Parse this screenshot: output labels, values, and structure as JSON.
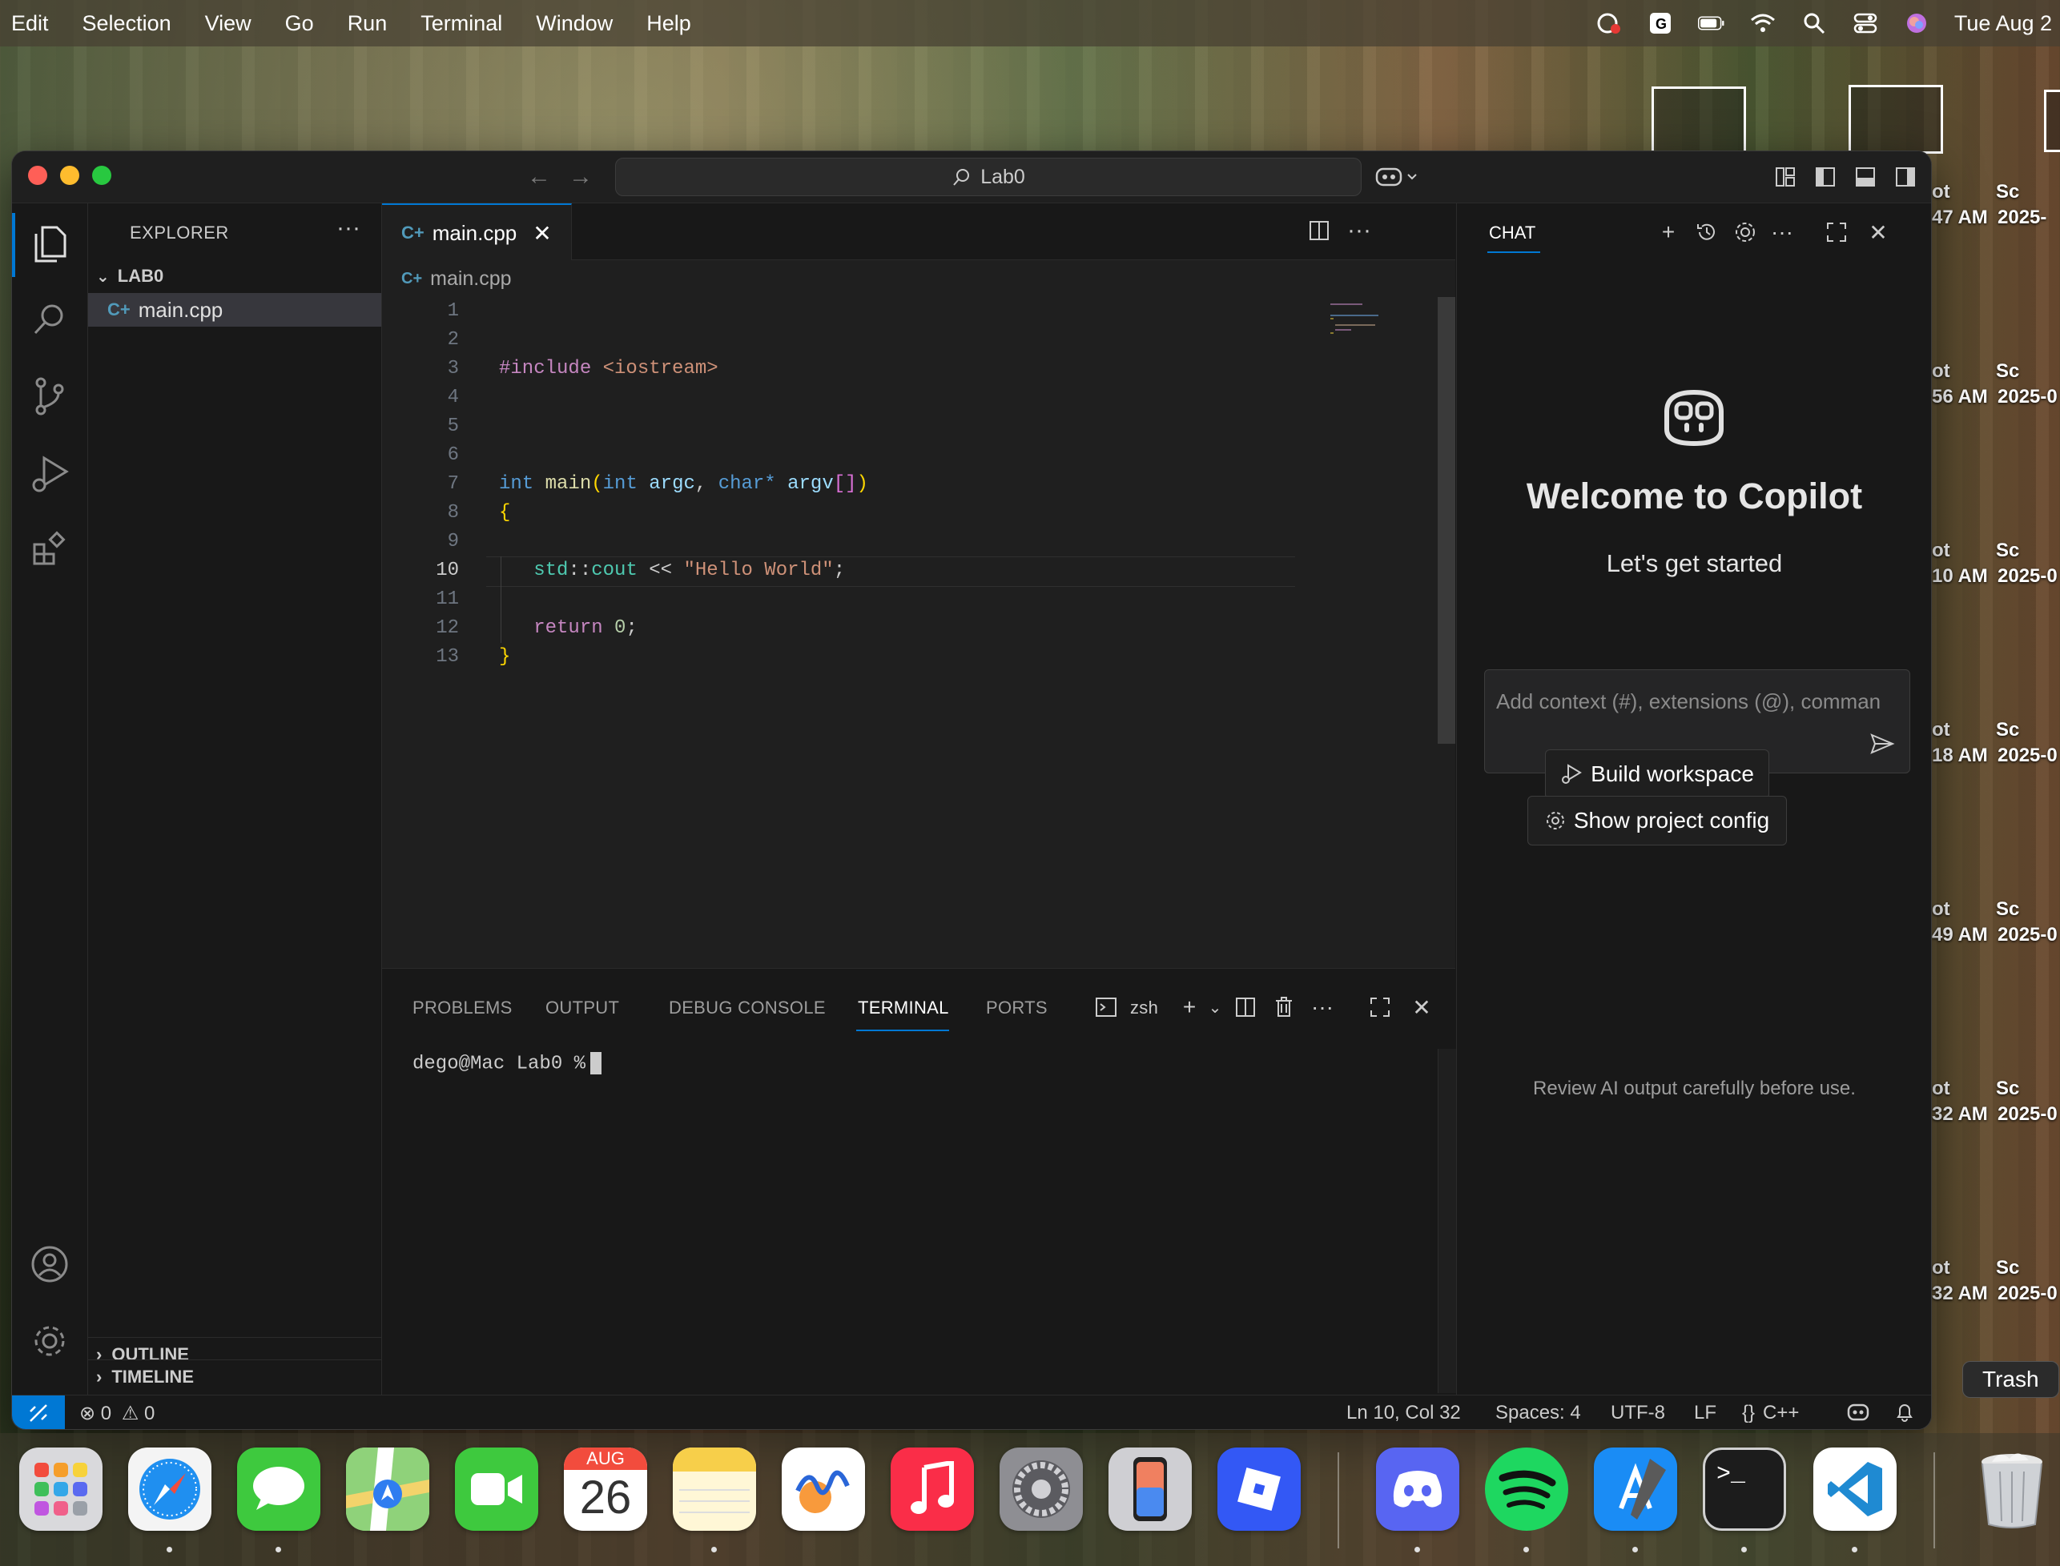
{
  "menubar": {
    "items": [
      "Edit",
      "Selection",
      "View",
      "Go",
      "Run",
      "Terminal",
      "Window",
      "Help"
    ],
    "clock": "Tue Aug 2",
    "icons": [
      "creative-cloud-icon",
      "grammarly-icon",
      "battery-icon",
      "wifi-icon",
      "spotlight-search-icon",
      "control-center-icon",
      "siri-icon"
    ]
  },
  "desktop": {
    "labels": [
      {
        "a": "ot",
        "b": "Sc"
      },
      {
        "a": "47 AM",
        "b": "2025-"
      },
      {
        "a": "ot",
        "b": "Sc"
      },
      {
        "a": "56 AM",
        "b": "2025-0"
      },
      {
        "a": "ot",
        "b": "Sc"
      },
      {
        "a": "10 AM",
        "b": "2025-0"
      },
      {
        "a": "ot",
        "b": "Sc"
      },
      {
        "a": "18 AM",
        "b": "2025-0"
      },
      {
        "a": "ot",
        "b": "Sc"
      },
      {
        "a": "49 AM",
        "b": "2025-0"
      },
      {
        "a": "ot",
        "b": "Sc"
      },
      {
        "a": "32 AM",
        "b": "2025-0"
      },
      {
        "a": "ot",
        "b": "Sc"
      },
      {
        "a": "32 AM",
        "b": "2025-0"
      }
    ],
    "trash_tooltip": "Trash"
  },
  "window": {
    "title_search": "Lab0",
    "explorer": {
      "title": "EXPLORER",
      "folder": "LAB0",
      "file": "main.cpp",
      "outline": "OUTLINE",
      "timeline": "TIMELINE"
    },
    "editor": {
      "tab_label": "main.cpp",
      "breadcrumb": "main.cpp",
      "line_numbers": [
        "1",
        "2",
        "3",
        "4",
        "5",
        "6",
        "7",
        "8",
        "9",
        "10",
        "11",
        "12",
        "13"
      ],
      "active_line": 10
    },
    "panel": {
      "tabs": [
        "PROBLEMS",
        "OUTPUT",
        "DEBUG CONSOLE",
        "TERMINAL",
        "PORTS"
      ],
      "active_tab": "TERMINAL",
      "shell": "zsh",
      "prompt": "dego@Mac Lab0 %"
    },
    "chat": {
      "title": "CHAT",
      "welcome": "Welcome to Copilot",
      "subtitle": "Let's get started",
      "input_placeholder": "Add context (#), extensions (@), comman",
      "build_button": "Build workspace",
      "config_button": "Show project config",
      "disclaimer": "Review AI output carefully before use."
    },
    "statusbar": {
      "errors": "0",
      "warnings": "0",
      "position": "Ln 10, Col 32",
      "spaces": "Spaces: 4",
      "encoding": "UTF-8",
      "eol": "LF",
      "language": "C++"
    }
  },
  "dock": {
    "apps": [
      "Launchpad",
      "Safari",
      "Messages",
      "Maps",
      "FaceTime",
      "Calendar",
      "Notes",
      "Freeform",
      "Music",
      "System Settings",
      "iPhone Mirroring",
      "Roblox",
      "Discord",
      "Spotify",
      "Xcode",
      "Terminal",
      "Visual Studio Code",
      "Trash"
    ],
    "calendar_month": "AUG",
    "calendar_day": "26"
  },
  "colors": {
    "accent": "#0078d4",
    "editor_bg": "#1f1f1f",
    "sidebar_bg": "#181818"
  }
}
